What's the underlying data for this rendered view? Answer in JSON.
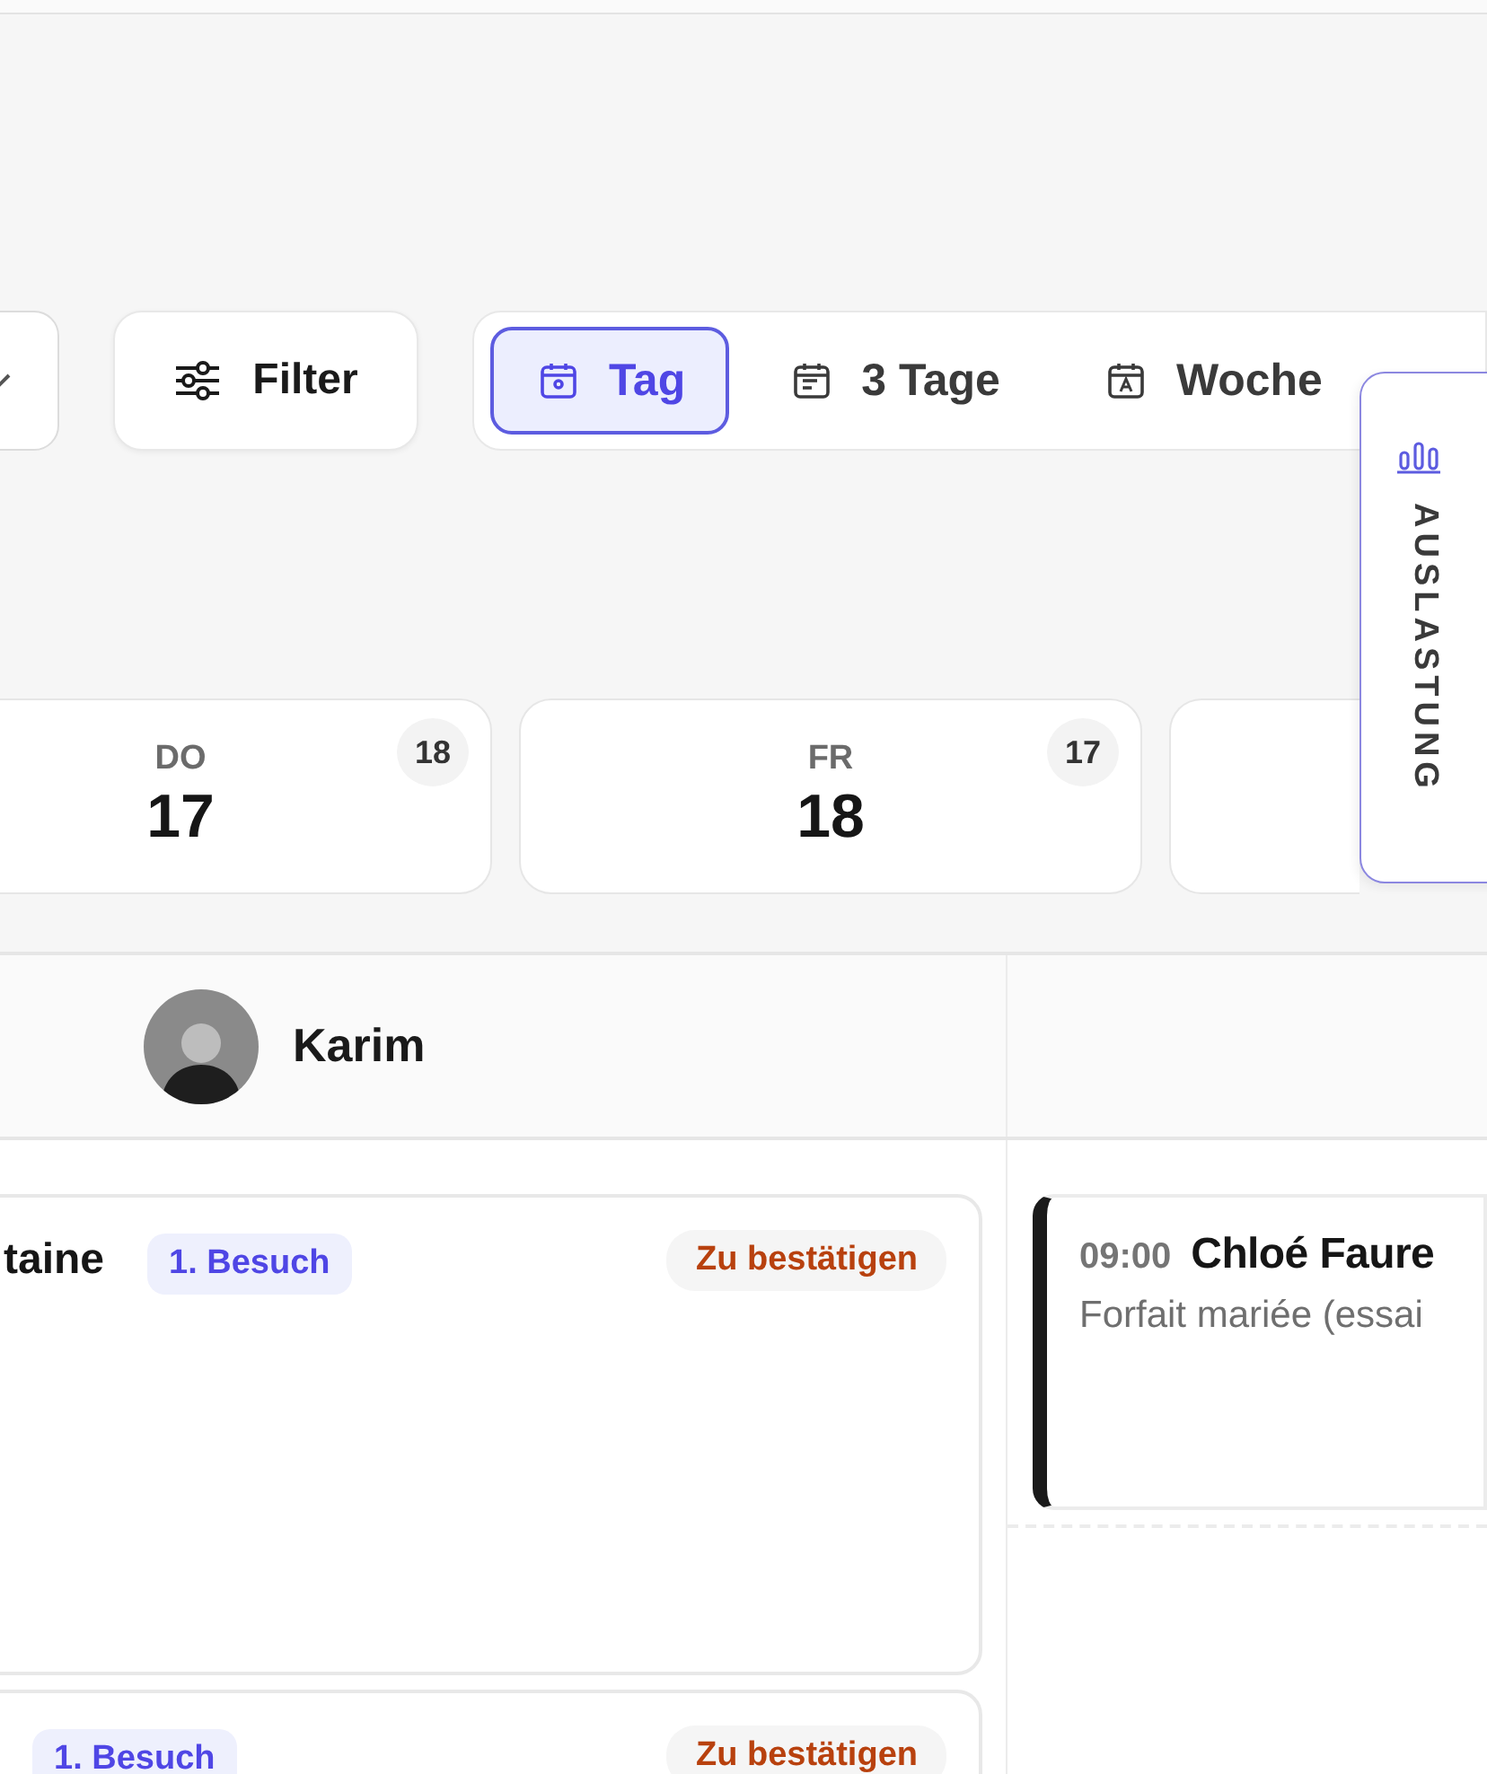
{
  "toolbar": {
    "filter_label": "Filter",
    "views": [
      {
        "kind": "day",
        "label": "Tag",
        "selected": true
      },
      {
        "kind": "three",
        "label": "3 Tage",
        "selected": false
      },
      {
        "kind": "week",
        "label": "Woche",
        "selected": false
      }
    ]
  },
  "side_tab": {
    "label": "AUSLASTUNG"
  },
  "days": [
    {
      "weekday": "DO",
      "date": "17",
      "count": "18"
    },
    {
      "weekday": "FR",
      "date": "18",
      "count": "17"
    }
  ],
  "staff": [
    {
      "name": "Karim"
    }
  ],
  "left_events": [
    {
      "name": "taine",
      "badge": "1. Besuch",
      "status": "Zu bestätigen"
    },
    {
      "badge": "1. Besuch",
      "status": "Zu bestätigen"
    }
  ],
  "right_events": [
    {
      "time": "09:00",
      "name": "Chloé Faure",
      "service": "Forfait mariée (essai"
    }
  ]
}
